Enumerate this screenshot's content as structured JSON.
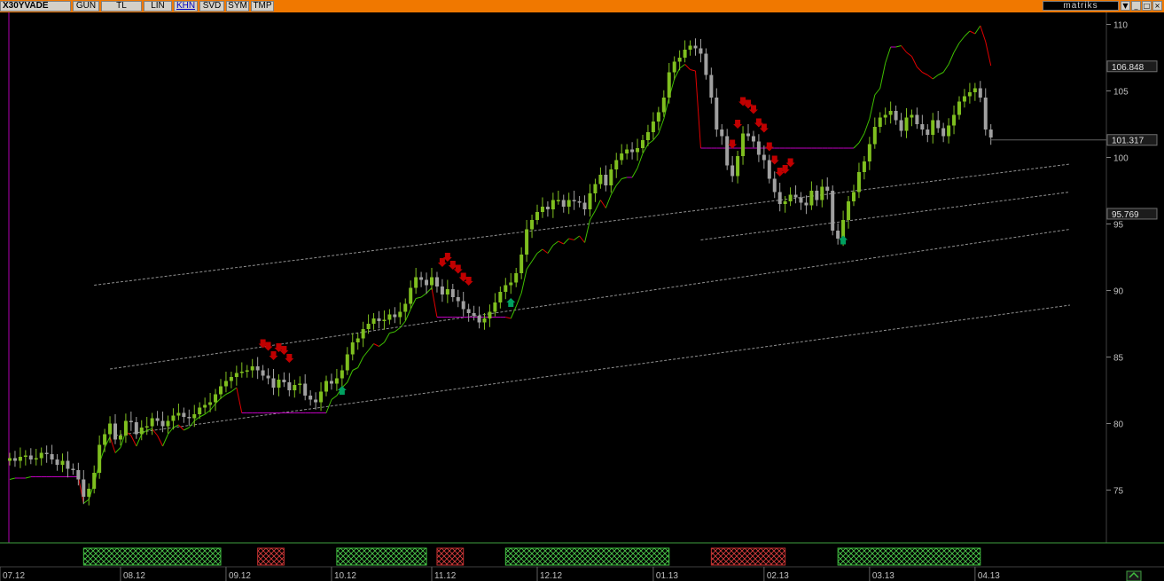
{
  "toolbar": {
    "symbol": "X30YVADE",
    "buttons": [
      "GUN",
      "TL",
      "LIN",
      "KHN",
      "SVD",
      "SYM",
      "TMP"
    ],
    "active_button": "KHN",
    "brand": "matriks"
  },
  "colors": {
    "bull_candle": "#7fbf1f",
    "bear_candle": "#a0a0a0",
    "sar_up": "#3fbf00",
    "sar_down": "#e00000",
    "flat_line": "#c000c0",
    "channel": "#909090",
    "sell_arrow": "#c00000",
    "buy_arrow": "#00a060",
    "green_band": "#40c040",
    "red_band": "#c03030"
  },
  "chart_data": {
    "type": "line",
    "title": "",
    "xlabel": "",
    "ylabel": "",
    "ylim": [
      71,
      111
    ],
    "y_ticks": [
      "110",
      "105",
      "100",
      "95",
      "90",
      "85",
      "80",
      "75"
    ],
    "x_tick_labels": [
      "07.12",
      "08.12",
      "09.12",
      "10.12",
      "11.12",
      "12.12",
      "01.13",
      "02.13",
      "03.13",
      "04.13"
    ],
    "x_tick_index": [
      0,
      21,
      41,
      61,
      80,
      100,
      122,
      143,
      163,
      183
    ],
    "price_labels": [
      {
        "label": "106.848",
        "value": 106.848
      },
      {
        "label": "101.317",
        "value": 101.317
      },
      {
        "label": "95.769",
        "value": 95.769
      }
    ],
    "series": [
      {
        "type": "line",
        "values": [
          77.4,
          77.2,
          77.5,
          77.6,
          77.3,
          77.4,
          77.8,
          77.7,
          77.3,
          76.9,
          77.2,
          76.6,
          76.5,
          75.8,
          74.5,
          75.1,
          76.3,
          78.4,
          79.2,
          80.0,
          78.8,
          79.1,
          80.2,
          80.1,
          79.2,
          79.7,
          79.8,
          80.4,
          80.2,
          79.8,
          80.2,
          80.6,
          80.8,
          80.5,
          80.4,
          80.7,
          81.2,
          81.4,
          81.6,
          82.2,
          82.8,
          83.2,
          83.5,
          83.8,
          83.9,
          84.0,
          84.3,
          84.0,
          83.6,
          83.4,
          82.7,
          83.3,
          83.1,
          82.5,
          82.9,
          83.0,
          82.1,
          81.8,
          81.6,
          82.4,
          83.2,
          83.0,
          83.4,
          84.0,
          85.2,
          86.1,
          86.4,
          87.1,
          87.5,
          87.9,
          87.7,
          87.8,
          88.2,
          88.0,
          88.4,
          89.0,
          90.2,
          91.0,
          90.8,
          90.4,
          91.0,
          90.3,
          89.7,
          90.1,
          89.5,
          89.2,
          88.6,
          88.3,
          88.1,
          87.6,
          87.9,
          88.4,
          89.1,
          89.9,
          90.4,
          90.6,
          91.3,
          92.7,
          94.6,
          95.3,
          95.9,
          96.3,
          96.1,
          96.8,
          96.8,
          96.3,
          96.8,
          96.7,
          96.6,
          96.1,
          97.3,
          98.0,
          98.7,
          97.9,
          99.1,
          99.8,
          100.3,
          100.6,
          100.4,
          100.7,
          101.3,
          101.9,
          102.7,
          103.4,
          104.5,
          106.4,
          107.2,
          107.5,
          108.1,
          108.4,
          108.2,
          107.8,
          106.2,
          104.5,
          102.1,
          101.6,
          99.4,
          98.6,
          100.1,
          101.8,
          101.6,
          101.2,
          100.2,
          99.8,
          98.4,
          97.4,
          96.5,
          96.7,
          97.2,
          97.0,
          96.6,
          96.4,
          97.5,
          96.8,
          97.8,
          97.5,
          94.5,
          93.9,
          95.3,
          96.7,
          97.4,
          98.9,
          99.7,
          101.0,
          102.3,
          103.0,
          103.2,
          103.5,
          102.8,
          102.0,
          103.0,
          103.2,
          102.5,
          102.1,
          101.7,
          102.8,
          102.2,
          101.6,
          102.4,
          103.2,
          104.2,
          104.6,
          104.9,
          105.2,
          104.5,
          102.1,
          101.5
        ]
      },
      {
        "type": "line",
        "values": [
          75.8,
          75.9,
          75.9,
          75.9,
          76.0,
          76.0,
          76.0,
          76.0,
          76.0,
          76.0,
          76.0,
          76.0,
          76.0,
          76.0,
          74.0,
          74.3,
          75.5,
          77.0,
          78.2,
          79.0,
          77.8,
          78.2,
          79.4,
          79.1,
          78.3,
          79.2,
          79.5,
          79.6,
          79.1,
          78.3,
          79.2,
          79.7,
          79.9,
          79.5,
          79.7,
          80.2,
          80.5,
          80.7,
          81.0,
          81.5,
          81.9,
          82.2,
          82.4,
          82.7,
          80.8,
          80.8,
          80.8,
          80.8,
          80.8,
          80.8,
          80.8,
          80.8,
          80.8,
          80.8,
          80.8,
          80.8,
          80.8,
          80.8,
          80.8,
          80.8,
          80.8,
          81.8,
          82.1,
          82.7,
          83.1,
          84.0,
          84.2,
          85.0,
          85.5,
          86.0,
          85.8,
          86.1,
          86.8,
          86.9,
          87.2,
          87.7,
          88.6,
          89.4,
          89.5,
          89.8,
          90.2,
          88.0,
          88.0,
          88.0,
          88.0,
          88.0,
          88.0,
          88.0,
          88.0,
          88.0,
          88.0,
          88.0,
          88.0,
          88.0,
          88.0,
          87.9,
          88.8,
          89.8,
          91.6,
          92.2,
          92.8,
          93.1,
          92.8,
          93.4,
          93.7,
          93.5,
          93.9,
          93.8,
          94.1,
          93.6,
          95.3,
          96.0,
          96.8,
          96.2,
          97.2,
          97.9,
          98.4,
          98.5,
          98.5,
          99.2,
          100.3,
          101.0,
          101.3,
          101.8,
          102.9,
          104.5,
          105.9,
          106.7,
          107.0,
          106.6,
          106.5,
          100.7,
          100.7,
          100.7,
          100.7,
          100.7,
          100.7,
          100.7,
          100.7,
          100.7,
          100.7,
          100.7,
          100.7,
          100.7,
          100.7,
          100.7,
          100.7,
          100.7,
          100.7,
          100.7,
          100.7,
          100.7,
          100.7,
          100.7,
          100.7,
          100.7,
          100.7,
          100.7,
          100.7,
          100.7,
          100.7,
          101.1,
          101.8,
          102.9,
          104.7,
          105.2,
          107.1,
          108.3,
          108.3,
          108.4,
          107.9,
          107.6,
          106.8,
          106.4,
          106.2,
          105.9,
          106.2,
          106.4,
          107.0,
          107.9,
          108.6,
          109.1,
          109.5,
          109.3,
          109.9,
          108.7,
          106.9,
          105.2
        ]
      }
    ],
    "channel_lines": [
      {
        "x": [
          16,
          201
        ],
        "y": [
          90.4,
          99.5
        ]
      },
      {
        "x": [
          19,
          201
        ],
        "y": [
          84.1,
          94.6
        ]
      },
      {
        "x": [
          20,
          201
        ],
        "y": [
          79.1,
          88.9
        ]
      },
      {
        "x": [
          131,
          201
        ],
        "y": [
          93.8,
          97.4
        ]
      }
    ],
    "sell_signals": [
      48,
      49,
      50,
      51,
      52,
      53,
      82,
      83,
      84,
      85,
      86,
      87,
      137,
      138,
      139,
      140,
      141,
      142,
      143,
      144,
      145,
      146,
      147,
      148
    ],
    "buy_signals": [
      63,
      95,
      158
    ],
    "indicator_bands": [
      {
        "from": 14,
        "to": 40,
        "signal": "buy"
      },
      {
        "from": 47,
        "to": 52,
        "signal": "sell"
      },
      {
        "from": 62,
        "to": 79,
        "signal": "buy"
      },
      {
        "from": 81,
        "to": 86,
        "signal": "sell"
      },
      {
        "from": 94,
        "to": 125,
        "signal": "buy"
      },
      {
        "from": 133,
        "to": 147,
        "signal": "sell"
      },
      {
        "from": 157,
        "to": 184,
        "signal": "buy"
      }
    ]
  }
}
